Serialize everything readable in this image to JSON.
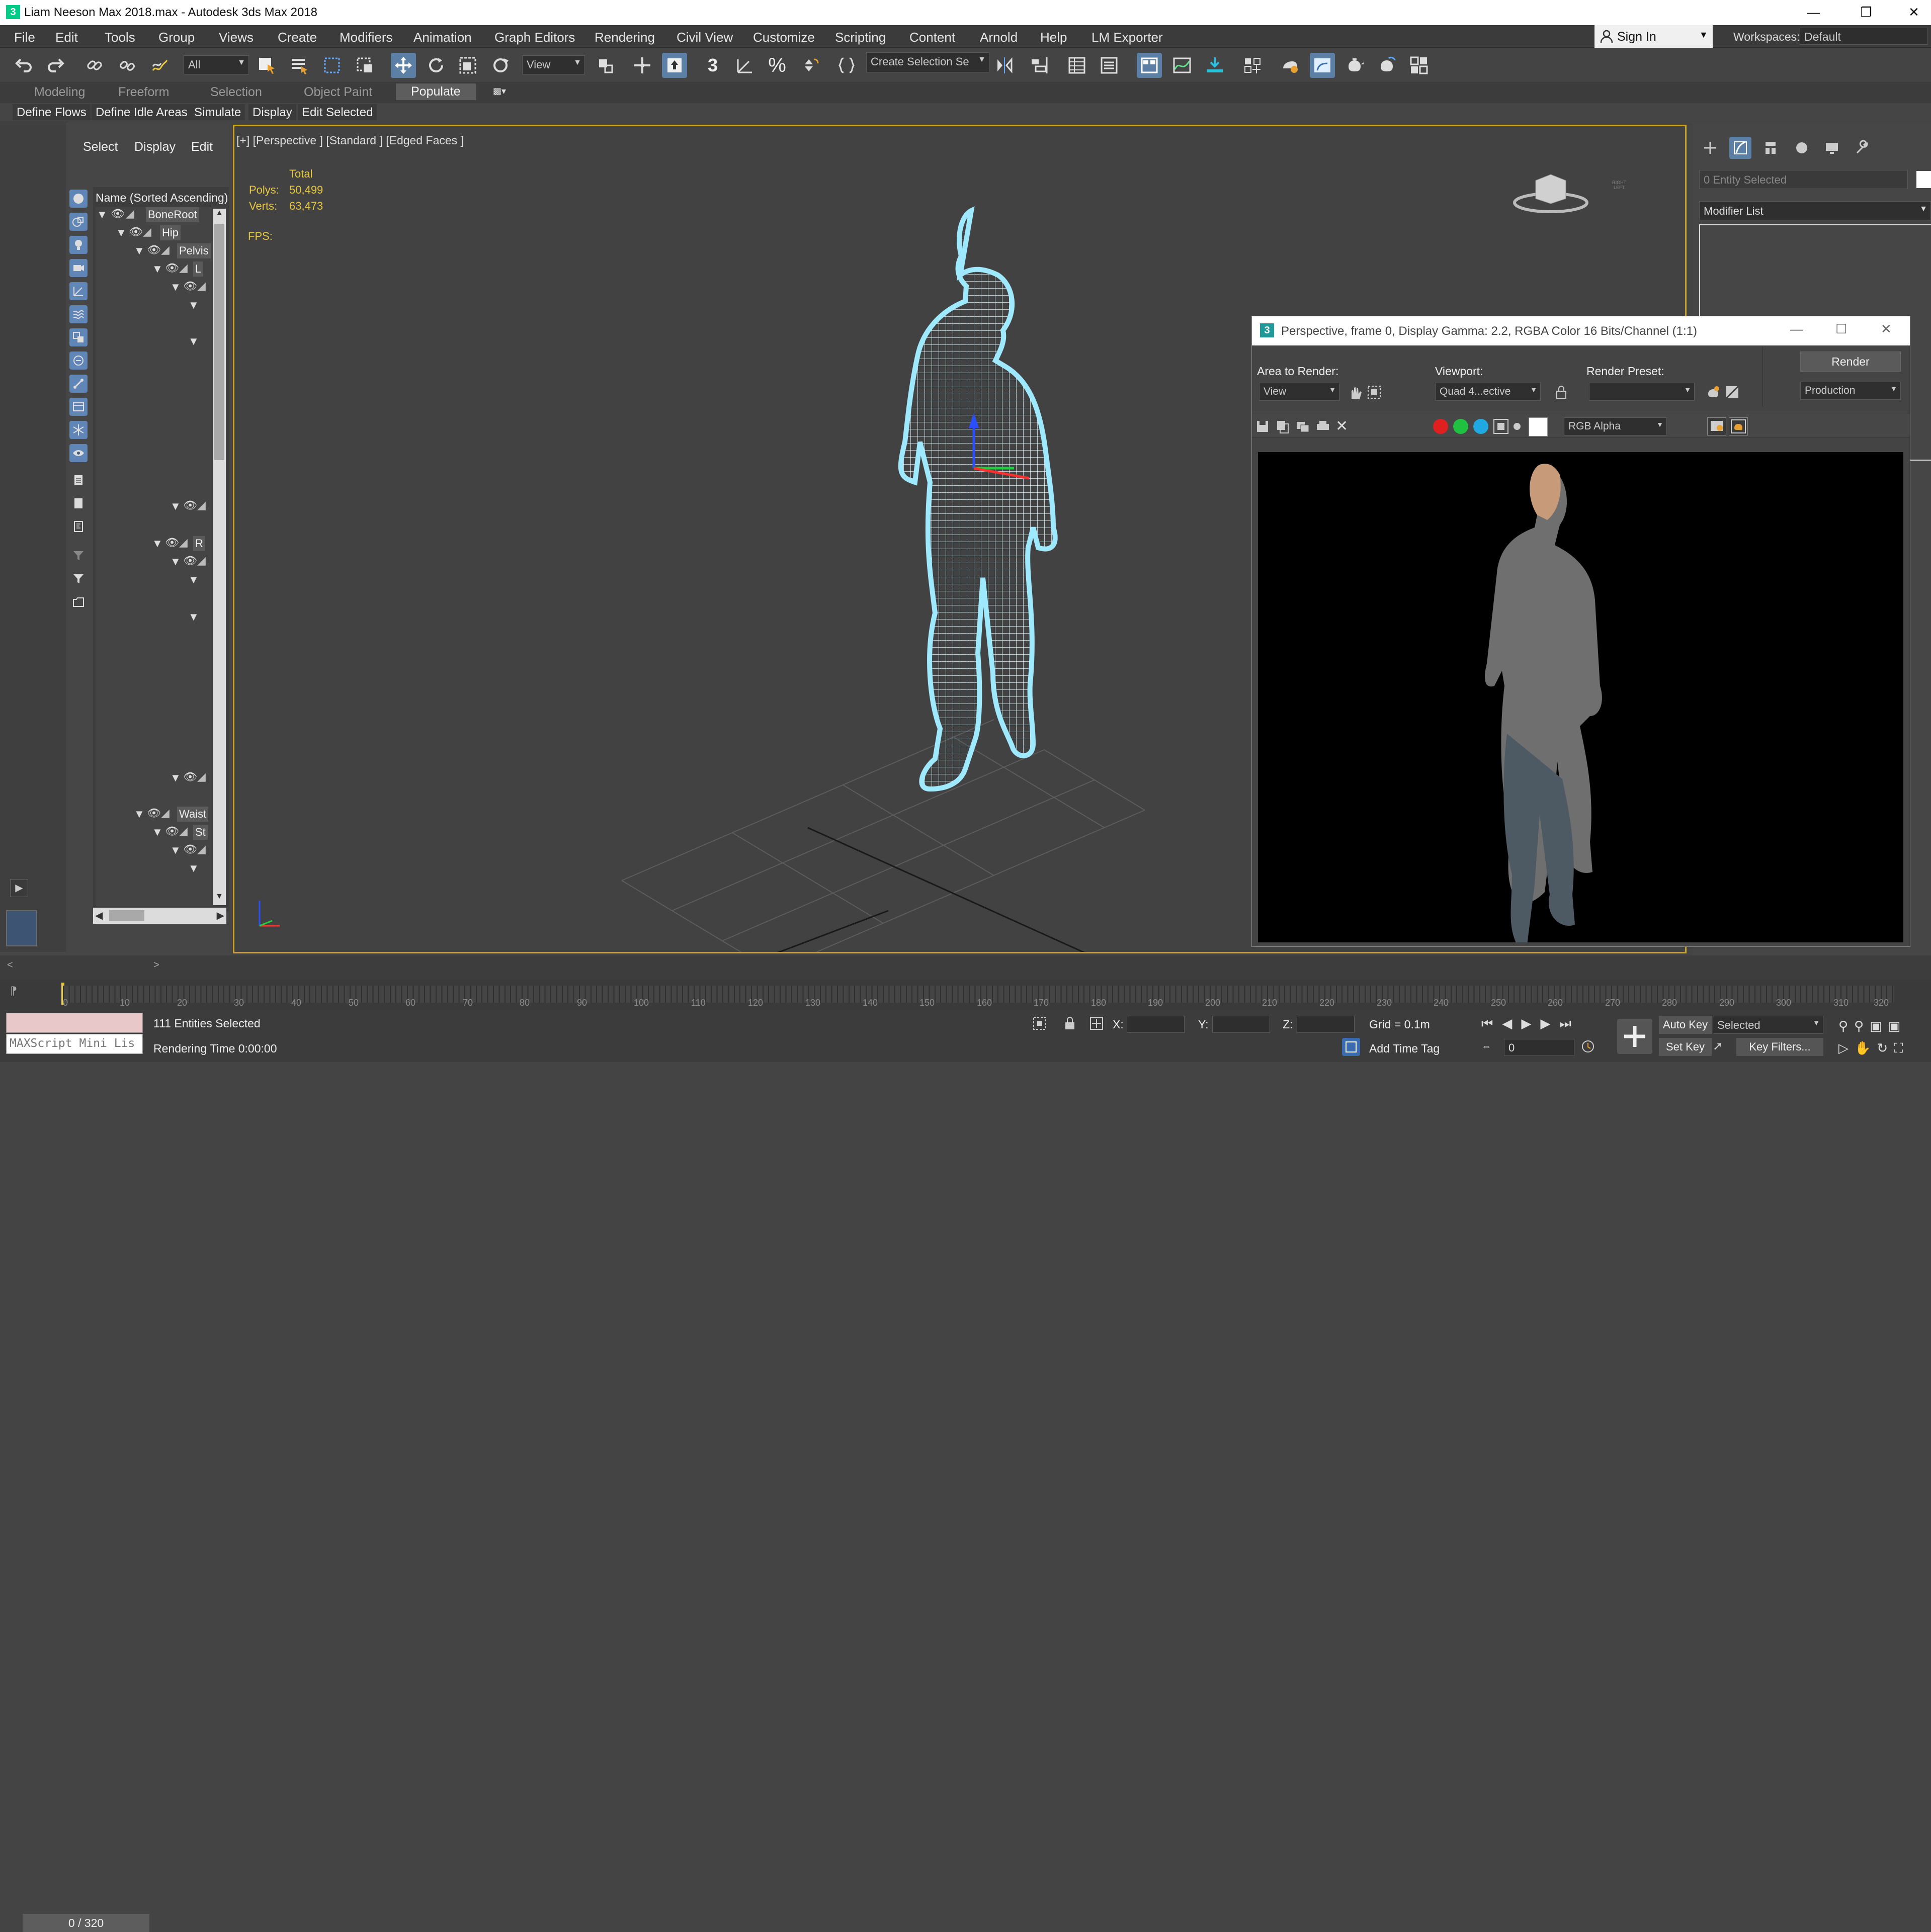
{
  "titlebar": {
    "title": "Liam Neeson Max 2018.max - Autodesk 3ds Max 2018"
  },
  "menu": [
    "File",
    "Edit",
    "Tools",
    "Group",
    "Views",
    "Create",
    "Modifiers",
    "Animation",
    "Graph Editors",
    "Rendering",
    "Civil View",
    "Customize",
    "Scripting",
    "Content",
    "Arnold",
    "Help",
    "LM Exporter"
  ],
  "signin": {
    "label": "Sign In"
  },
  "workspaces": {
    "label": "Workspaces:",
    "value": "Default"
  },
  "toolbar": {
    "filter_value": "All",
    "coord_value": "View",
    "selection_set_placeholder": "Create Selection Se",
    "snap_label": "3"
  },
  "ribbon": {
    "tabs": [
      "Modeling",
      "Freeform",
      "Selection",
      "Object Paint",
      "Populate"
    ],
    "active_tab": "Populate",
    "buttons": [
      "Define Flows",
      "Define Idle Areas",
      "Simulate",
      "Display",
      "Edit Selected"
    ]
  },
  "scene_explorer": {
    "menu": [
      "Select",
      "Display",
      "Edit"
    ],
    "column_header": "Name (Sorted Ascending)",
    "nodes": [
      {
        "label": "BoneRoot"
      },
      {
        "label": "Hip"
      },
      {
        "label": "Pelvis"
      },
      {
        "label": "L"
      },
      {
        "label": "R"
      },
      {
        "label": "Waist"
      },
      {
        "label": "St"
      }
    ]
  },
  "viewport": {
    "label": "[+] [Perspective ] [Standard ] [Edged Faces ]",
    "stats": {
      "header": "Total",
      "polys_label": "Polys:",
      "polys_value": "50,499",
      "verts_label": "Verts:",
      "verts_value": "63,473"
    },
    "fps_label": "FPS:",
    "viewcube_labels": [
      "RIGHT",
      "LEFT"
    ]
  },
  "command_panel": {
    "entity_field": "0 Entity Selected",
    "modifier_list": "Modifier List"
  },
  "frame_buffer": {
    "title": "Perspective, frame 0, Display Gamma: 2.2, RGBA Color 16 Bits/Channel (1:1)",
    "area_label": "Area to Render:",
    "area_value": "View",
    "viewport_label": "Viewport:",
    "viewport_value": "Quad 4...ective",
    "preset_label": "Render Preset:",
    "preset_value": "",
    "render_button": "Render",
    "render_mode": "Production",
    "channel_value": "RGB Alpha",
    "channel_colors": {
      "red": "#e02020",
      "green": "#20c040",
      "blue": "#20a8e0"
    }
  },
  "timeline": {
    "frame_readout": "0 / 320",
    "ticks": [
      "0",
      "10",
      "20",
      "30",
      "40",
      "50",
      "60",
      "70",
      "80",
      "90",
      "100",
      "110",
      "120",
      "130",
      "140",
      "150",
      "160",
      "170",
      "180",
      "190",
      "200",
      "210",
      "220",
      "230",
      "240",
      "250",
      "260",
      "270",
      "280",
      "290",
      "300",
      "310",
      "320"
    ]
  },
  "status": {
    "maxscript": "MAXScript Mini Lis",
    "selected": "111 Entities Selected",
    "rendering_time": "Rendering Time  0:00:00",
    "x_label": "X:",
    "y_label": "Y:",
    "z_label": "Z:",
    "grid": "Grid = 0.1m",
    "add_time_tag": "Add Time Tag",
    "auto_key": "Auto Key",
    "set_key": "Set Key",
    "key_mode_value": "Selected",
    "key_filters": "Key Filters...",
    "frame_value": "0"
  },
  "colors": {
    "accent": "#5c7fa6",
    "viewport_border": "#c9a227",
    "wireframe": "#c8f4ff",
    "stats_text": "#e8c840"
  }
}
